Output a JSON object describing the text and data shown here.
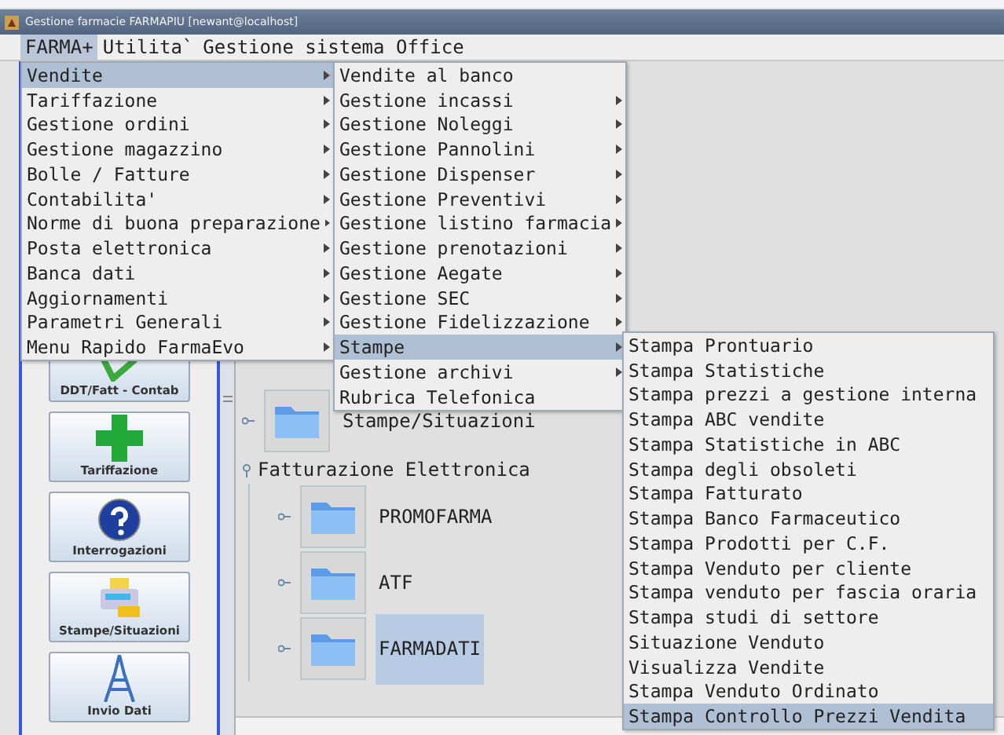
{
  "window": {
    "title": "Gestione farmacie FARMAPIU [newant@localhost]"
  },
  "menubar": [
    {
      "label": "FARMA+",
      "selected": true
    },
    {
      "label": "Utilita`",
      "selected": false
    },
    {
      "label": "Gestione sistema Office",
      "selected": false
    }
  ],
  "menus": [
    {
      "items": [
        {
          "label": "Vendite",
          "selected": true,
          "submenu": true
        },
        {
          "label": "Tariffazione",
          "selected": false,
          "submenu": true
        },
        {
          "label": "Gestione ordini",
          "selected": false,
          "submenu": true
        },
        {
          "label": "Gestione magazzino",
          "selected": false,
          "submenu": true
        },
        {
          "label": "Bolle / Fatture",
          "selected": false,
          "submenu": true
        },
        {
          "label": "Contabilita'",
          "selected": false,
          "submenu": true
        },
        {
          "label": "Norme di buona preparazione",
          "selected": false,
          "submenu": true
        },
        {
          "label": "Posta elettronica",
          "selected": false,
          "submenu": true
        },
        {
          "label": "Banca dati",
          "selected": false,
          "submenu": true
        },
        {
          "label": "Aggiornamenti",
          "selected": false,
          "submenu": true
        },
        {
          "label": "Parametri Generali",
          "selected": false,
          "submenu": true
        },
        {
          "label": "Menu Rapido FarmaEvo",
          "selected": false,
          "submenu": true
        }
      ]
    },
    {
      "items": [
        {
          "label": "Vendite al banco",
          "selected": false,
          "submenu": false
        },
        {
          "label": "Gestione incassi",
          "selected": false,
          "submenu": true
        },
        {
          "label": "Gestione Noleggi",
          "selected": false,
          "submenu": true
        },
        {
          "label": "Gestione Pannolini",
          "selected": false,
          "submenu": true
        },
        {
          "label": "Gestione Dispenser",
          "selected": false,
          "submenu": true
        },
        {
          "label": "Gestione Preventivi",
          "selected": false,
          "submenu": true
        },
        {
          "label": "Gestione listino farmacia",
          "selected": false,
          "submenu": true
        },
        {
          "label": "Gestione prenotazioni",
          "selected": false,
          "submenu": true
        },
        {
          "label": "Gestione Aegate",
          "selected": false,
          "submenu": true
        },
        {
          "label": "Gestione SEC",
          "selected": false,
          "submenu": true
        },
        {
          "label": "Gestione Fidelizzazione",
          "selected": false,
          "submenu": true
        },
        {
          "label": "Stampe",
          "selected": true,
          "submenu": true
        },
        {
          "label": "Gestione archivi",
          "selected": false,
          "submenu": true
        },
        {
          "label": "Rubrica Telefonica",
          "selected": false,
          "submenu": false
        }
      ]
    },
    {
      "items": [
        {
          "label": "Stampa Prontuario",
          "selected": false,
          "submenu": false
        },
        {
          "label": "Stampa Statistiche",
          "selected": false,
          "submenu": false
        },
        {
          "label": "Stampa prezzi a gestione interna",
          "selected": false,
          "submenu": false
        },
        {
          "label": "Stampa ABC vendite",
          "selected": false,
          "submenu": false
        },
        {
          "label": "Stampa Statistiche in ABC",
          "selected": false,
          "submenu": false
        },
        {
          "label": "Stampa degli obsoleti",
          "selected": false,
          "submenu": false
        },
        {
          "label": "Stampa Fatturato",
          "selected": false,
          "submenu": false
        },
        {
          "label": "Stampa Banco Farmaceutico",
          "selected": false,
          "submenu": false
        },
        {
          "label": "Stampa Prodotti per C.F.",
          "selected": false,
          "submenu": false
        },
        {
          "label": "Stampa Venduto per cliente",
          "selected": false,
          "submenu": false
        },
        {
          "label": "Stampa venduto per fascia oraria",
          "selected": false,
          "submenu": false
        },
        {
          "label": "Stampa studi di settore",
          "selected": false,
          "submenu": false
        },
        {
          "label": "Situazione Venduto",
          "selected": false,
          "submenu": false
        },
        {
          "label": "Visualizza Vendite",
          "selected": false,
          "submenu": false
        },
        {
          "label": "Stampa Venduto Ordinato",
          "selected": false,
          "submenu": false
        },
        {
          "label": "Stampa Controllo Prezzi Vendita",
          "selected": true,
          "submenu": false
        }
      ]
    }
  ],
  "sidebar": {
    "buttons": [
      {
        "label": "DDT/Fatt - Contab",
        "kind": "check"
      },
      {
        "label": "Tariffazione",
        "kind": "cross"
      },
      {
        "label": "Interrogazioni",
        "kind": "question"
      },
      {
        "label": "Stampe/Situazioni",
        "kind": "printer"
      },
      {
        "label": "Invio Dati",
        "kind": "tower"
      }
    ]
  },
  "tree": {
    "nodes": [
      {
        "label": "Stampe/Situazioni",
        "kind": "folder",
        "selected": false
      },
      {
        "label": "Fatturazione Elettronica",
        "kind": "group",
        "expanded": true,
        "children": [
          {
            "label": "PROMOFARMA",
            "kind": "folder",
            "selected": false
          },
          {
            "label": "ATF",
            "kind": "folder",
            "selected": false
          },
          {
            "label": "FARMADATI",
            "kind": "folder",
            "selected": true
          }
        ]
      }
    ]
  }
}
